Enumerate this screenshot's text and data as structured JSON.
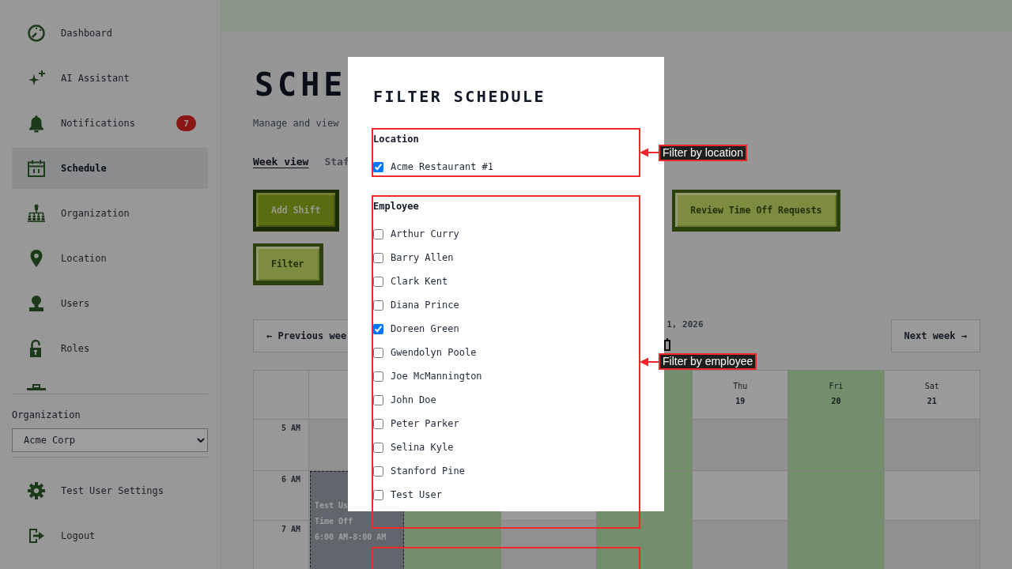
{
  "sidebar": {
    "nav": [
      {
        "label": "Dashboard",
        "selected": false
      },
      {
        "label": "AI Assistant",
        "selected": false
      },
      {
        "label": "Notifications",
        "selected": false,
        "badge": "7"
      },
      {
        "label": "Schedule",
        "selected": true
      },
      {
        "label": "Organization",
        "selected": false
      },
      {
        "label": "Location",
        "selected": false
      },
      {
        "label": "Users",
        "selected": false
      },
      {
        "label": "Roles",
        "selected": false
      }
    ],
    "organization": {
      "label": "Organization",
      "value": "Acme Corp"
    },
    "footer": [
      {
        "label": "Test User Settings"
      },
      {
        "label": "Logout"
      }
    ]
  },
  "page": {
    "title": "SCHE",
    "subtitle": "Manage and view",
    "tabs": [
      {
        "label": "Week view",
        "selected": true
      },
      {
        "label": "Staf",
        "selected": false
      }
    ],
    "actions": [
      {
        "label": "Add Shift",
        "kind": "primary"
      },
      {
        "label": "Review Time Off Requests",
        "kind": "secondary"
      },
      {
        "label": "Filter",
        "kind": "secondary"
      }
    ],
    "week_nav": {
      "previous": "← Previous wee",
      "range": "1, 2026",
      "next": "Next week →"
    },
    "calendar": {
      "columns": [
        {
          "highlighted": false
        },
        {
          "highlighted": true
        },
        {
          "highlighted": false
        },
        {
          "highlighted": true
        },
        {
          "day": "Thu",
          "date": "19",
          "highlighted": false
        },
        {
          "day": "Fri",
          "date": "20",
          "highlighted": true
        },
        {
          "day": "Sat",
          "date": "21",
          "highlighted": false
        }
      ],
      "hours": [
        "5 AM",
        "6 AM",
        "7 AM"
      ],
      "events": [
        {
          "employee": "Test Us",
          "label": "Time Off",
          "time": "6:00 AM-8:00 AM"
        }
      ]
    }
  },
  "modal": {
    "title": "FILTER SCHEDULE",
    "groups": [
      {
        "label": "Location",
        "options": [
          {
            "label": "Acme Restaurant #1",
            "checked": true
          }
        ]
      },
      {
        "label": "Employee",
        "options": [
          {
            "label": "Arthur Curry",
            "checked": false
          },
          {
            "label": "Barry Allen",
            "checked": false
          },
          {
            "label": "Clark Kent",
            "checked": false
          },
          {
            "label": "Diana Prince",
            "checked": false
          },
          {
            "label": "Doreen Green",
            "checked": true
          },
          {
            "label": "Gwendolyn Poole",
            "checked": false
          },
          {
            "label": "Joe McMannington",
            "checked": false
          },
          {
            "label": "John Doe",
            "checked": false
          },
          {
            "label": "Peter Parker",
            "checked": false
          },
          {
            "label": "Selina Kyle",
            "checked": false
          },
          {
            "label": "Stanford Pine",
            "checked": false
          },
          {
            "label": "Test User",
            "checked": false
          }
        ]
      }
    ]
  },
  "annotations": [
    {
      "kind": "callout",
      "label": "Filter by location"
    },
    {
      "kind": "callout",
      "label": "Filter by employee"
    },
    {
      "kind": "frame"
    }
  ]
}
